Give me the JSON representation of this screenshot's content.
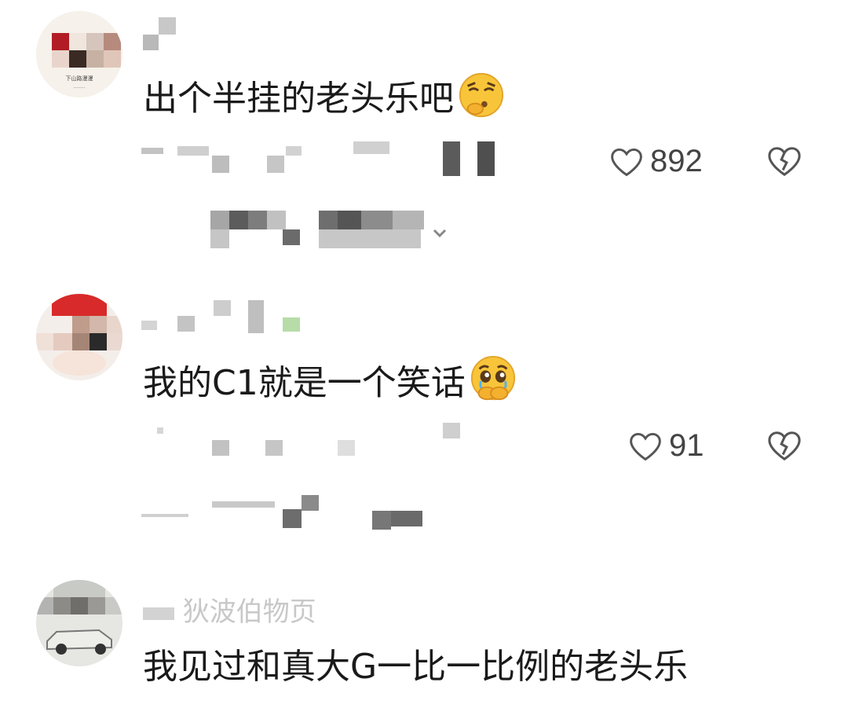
{
  "comments": [
    {
      "text": "出个半挂的老头乐吧",
      "likes": "892",
      "emoji": "thinking-face-emoji"
    },
    {
      "text": "我的C1就是一个笑话",
      "likes": "91",
      "emoji": "holding-back-tears-emoji"
    },
    {
      "text": "我见过和真大G一比一比例的老头乐",
      "partial_username": "狄波伯物页"
    }
  ],
  "icons": {
    "like": "heart-outline-icon",
    "dislike": "broken-heart-icon"
  },
  "colors": {
    "text": "#1a1a1a",
    "icon": "#555555",
    "mosaic_gray": "#9a9a9a"
  }
}
